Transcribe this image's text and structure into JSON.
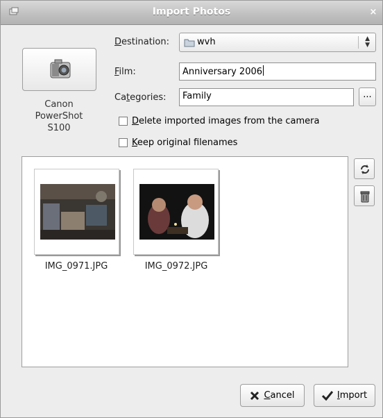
{
  "window": {
    "title": "Import Photos",
    "close_glyph": "×"
  },
  "camera": {
    "label_line1": "Canon",
    "label_line2": "PowerShot",
    "label_line3": "S100",
    "icon": "camera-icon"
  },
  "destination": {
    "label_u": "D",
    "label_rest": "estination:",
    "value": "wvh",
    "icon": "folder-icon"
  },
  "film": {
    "label_u": "F",
    "label_rest": "ilm:",
    "value": "Anniversary 2006"
  },
  "categories": {
    "label_pre": "Ca",
    "label_u": "t",
    "label_rest": "egories:",
    "value": "Family",
    "more_label": "..."
  },
  "options": [
    {
      "u": "D",
      "rest": "elete imported images from the camera",
      "checked": false
    },
    {
      "u": "K",
      "rest": "eep original filenames",
      "checked": false
    }
  ],
  "photos": [
    {
      "filename": "IMG_0971.JPG"
    },
    {
      "filename": "IMG_0972.JPG"
    }
  ],
  "side_buttons": {
    "rotate_icon": "rotate-icon",
    "delete_icon": "trash-icon"
  },
  "buttons": {
    "cancel_u": "C",
    "cancel_rest": "ancel",
    "import_u": "I",
    "import_rest": "mport"
  }
}
